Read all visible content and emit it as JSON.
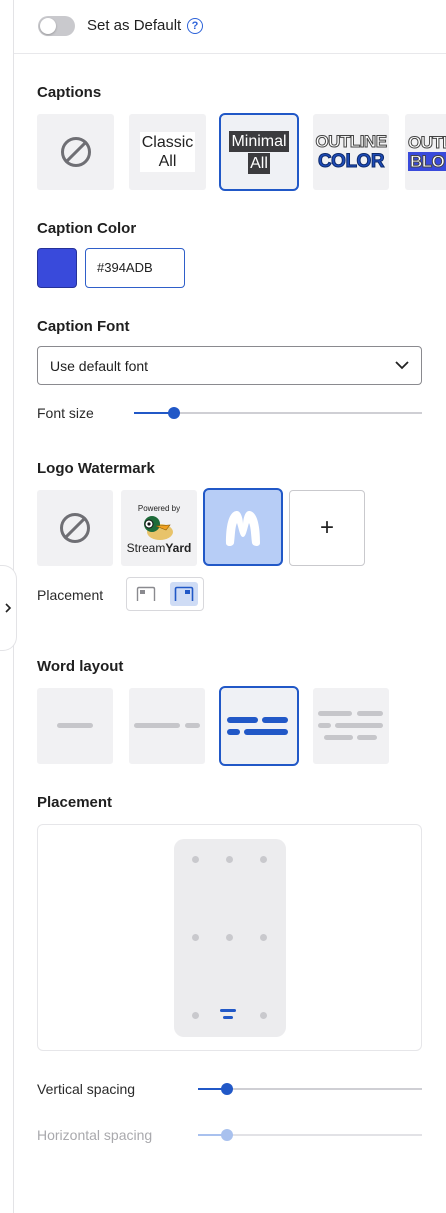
{
  "header": {
    "set_default_label": "Set as Default",
    "help_glyph": "?",
    "toggle_on": false
  },
  "captions": {
    "title": "Captions",
    "styles": [
      {
        "name": "None",
        "icon": "no-symbol-icon"
      },
      {
        "name": "Classic All",
        "line1": "Classic",
        "line2": "All"
      },
      {
        "name": "Minimal All",
        "line1": "Minimal",
        "line2": "All",
        "selected": true
      },
      {
        "name": "Outline Color",
        "line1": "OUTLINE",
        "line2": "COLOR"
      },
      {
        "name": "Outline Block",
        "line1": "OUTL",
        "line2": "BLO"
      }
    ]
  },
  "caption_color": {
    "title": "Caption Color",
    "value": "#394ADB",
    "swatch": "#394ADB"
  },
  "caption_font": {
    "title": "Caption Font",
    "selected": "Use default font",
    "font_size_label": "Font size",
    "font_size_level": 0.14
  },
  "logo_watermark": {
    "title": "Logo Watermark",
    "logos": [
      {
        "name": "None",
        "icon": "no-symbol-icon"
      },
      {
        "name": "StreamYard",
        "powered_by": "Powered by",
        "brand_a": "Stream",
        "brand_b": "Yard"
      },
      {
        "name": "M logo",
        "selected": true
      }
    ],
    "add_glyph": "+",
    "placement_label": "Placement",
    "placement_active": "top-right"
  },
  "word_layout": {
    "title": "Word layout",
    "selected_index": 2
  },
  "placement": {
    "title": "Placement",
    "selected": "bottom-center"
  },
  "spacing": {
    "vertical_label": "Vertical spacing",
    "vertical_level": 0.13,
    "horizontal_label": "Horizontal spacing",
    "horizontal_level": 0.13,
    "horizontal_disabled": true
  },
  "colors": {
    "accent": "#2158c7",
    "light_accent": "#b7cdf6"
  }
}
